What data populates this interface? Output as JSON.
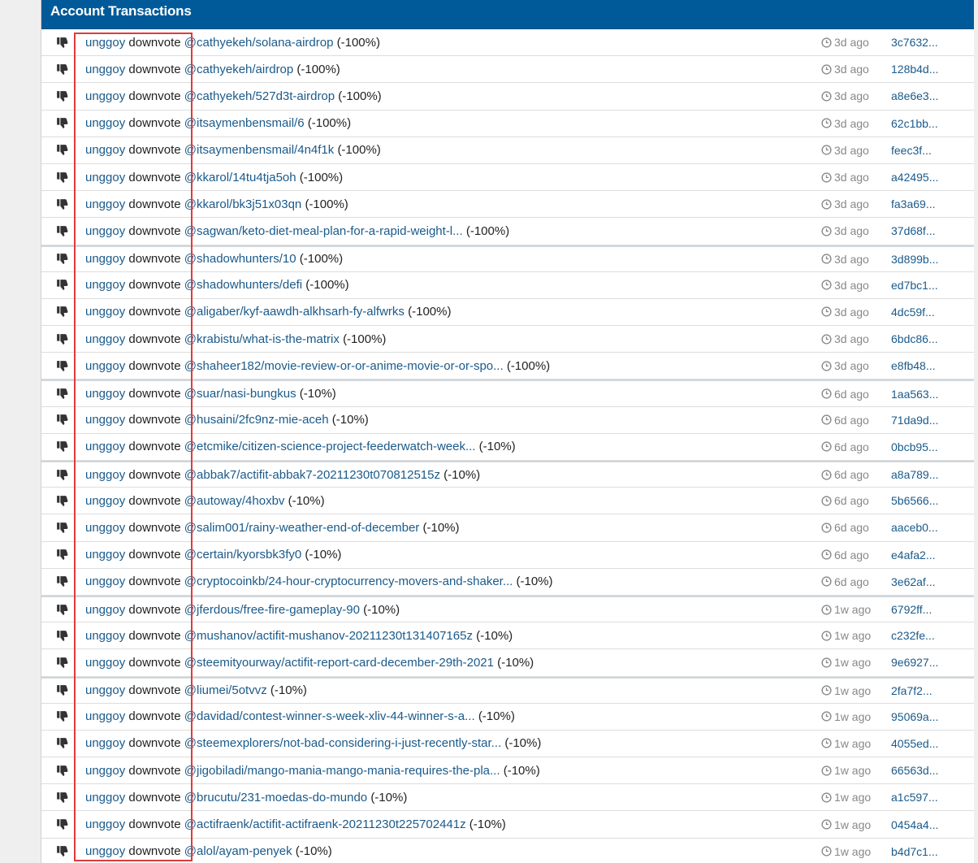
{
  "panel": {
    "title": "Account Transactions"
  },
  "colors": {
    "header_bg": "#005a99",
    "link": "#1a5a8a",
    "highlight": "#e03a3a"
  },
  "icons": {
    "row_icon": "thumbs-down-icon",
    "time_icon": "clock-icon"
  },
  "transactions": [
    {
      "voter": "unggoy",
      "op": "downvote",
      "target": "@cathyekeh/solana-airdrop",
      "weight": "(-100%)",
      "time": "3d ago",
      "hash": "3c7632..."
    },
    {
      "voter": "unggoy",
      "op": "downvote",
      "target": "@cathyekeh/airdrop",
      "weight": "(-100%)",
      "time": "3d ago",
      "hash": "128b4d..."
    },
    {
      "voter": "unggoy",
      "op": "downvote",
      "target": "@cathyekeh/527d3t-airdrop",
      "weight": "(-100%)",
      "time": "3d ago",
      "hash": "a8e6e3..."
    },
    {
      "voter": "unggoy",
      "op": "downvote",
      "target": "@itsaymenbensmail/6",
      "weight": "(-100%)",
      "time": "3d ago",
      "hash": "62c1bb..."
    },
    {
      "voter": "unggoy",
      "op": "downvote",
      "target": "@itsaymenbensmail/4n4f1k",
      "weight": "(-100%)",
      "time": "3d ago",
      "hash": "feec3f..."
    },
    {
      "voter": "unggoy",
      "op": "downvote",
      "target": "@kkarol/14tu4tja5oh",
      "weight": "(-100%)",
      "time": "3d ago",
      "hash": "a42495..."
    },
    {
      "voter": "unggoy",
      "op": "downvote",
      "target": "@kkarol/bk3j51x03qn",
      "weight": "(-100%)",
      "time": "3d ago",
      "hash": "fa3a69..."
    },
    {
      "voter": "unggoy",
      "op": "downvote",
      "target": "@sagwan/keto-diet-meal-plan-for-a-rapid-weight-l...",
      "weight": "(-100%)",
      "time": "3d ago",
      "hash": "37d68f..."
    },
    {
      "voter": "unggoy",
      "op": "downvote",
      "target": "@shadowhunters/10",
      "weight": "(-100%)",
      "time": "3d ago",
      "hash": "3d899b..."
    },
    {
      "voter": "unggoy",
      "op": "downvote",
      "target": "@shadowhunters/defi",
      "weight": "(-100%)",
      "time": "3d ago",
      "hash": "ed7bc1..."
    },
    {
      "voter": "unggoy",
      "op": "downvote",
      "target": "@aligaber/kyf-aawdh-alkhsarh-fy-alfwrks",
      "weight": "(-100%)",
      "time": "3d ago",
      "hash": "4dc59f..."
    },
    {
      "voter": "unggoy",
      "op": "downvote",
      "target": "@krabistu/what-is-the-matrix",
      "weight": "(-100%)",
      "time": "3d ago",
      "hash": "6bdc86..."
    },
    {
      "voter": "unggoy",
      "op": "downvote",
      "target": "@shaheer182/movie-review-or-or-anime-movie-or-or-spo...",
      "weight": "(-100%)",
      "time": "3d ago",
      "hash": "e8fb48..."
    },
    {
      "voter": "unggoy",
      "op": "downvote",
      "target": "@suar/nasi-bungkus",
      "weight": "(-10%)",
      "time": "6d ago",
      "hash": "1aa563..."
    },
    {
      "voter": "unggoy",
      "op": "downvote",
      "target": "@husaini/2fc9nz-mie-aceh",
      "weight": "(-10%)",
      "time": "6d ago",
      "hash": "71da9d..."
    },
    {
      "voter": "unggoy",
      "op": "downvote",
      "target": "@etcmike/citizen-science-project-feederwatch-week...",
      "weight": "(-10%)",
      "time": "6d ago",
      "hash": "0bcb95..."
    },
    {
      "voter": "unggoy",
      "op": "downvote",
      "target": "@abbak7/actifit-abbak7-20211230t070812515z",
      "weight": "(-10%)",
      "time": "6d ago",
      "hash": "a8a789..."
    },
    {
      "voter": "unggoy",
      "op": "downvote",
      "target": "@autoway/4hoxbv",
      "weight": "(-10%)",
      "time": "6d ago",
      "hash": "5b6566..."
    },
    {
      "voter": "unggoy",
      "op": "downvote",
      "target": "@salim001/rainy-weather-end-of-december",
      "weight": "(-10%)",
      "time": "6d ago",
      "hash": "aaceb0..."
    },
    {
      "voter": "unggoy",
      "op": "downvote",
      "target": "@certain/kyorsbk3fy0",
      "weight": "(-10%)",
      "time": "6d ago",
      "hash": "e4afa2..."
    },
    {
      "voter": "unggoy",
      "op": "downvote",
      "target": "@cryptocoinkb/24-hour-cryptocurrency-movers-and-shaker...",
      "weight": "(-10%)",
      "time": "6d ago",
      "hash": "3e62af..."
    },
    {
      "voter": "unggoy",
      "op": "downvote",
      "target": "@jferdous/free-fire-gameplay-90",
      "weight": "(-10%)",
      "time": "1w ago",
      "hash": "6792ff..."
    },
    {
      "voter": "unggoy",
      "op": "downvote",
      "target": "@mushanov/actifit-mushanov-20211230t131407165z",
      "weight": "(-10%)",
      "time": "1w ago",
      "hash": "c232fe..."
    },
    {
      "voter": "unggoy",
      "op": "downvote",
      "target": "@steemityourway/actifit-report-card-december-29th-2021",
      "weight": "(-10%)",
      "time": "1w ago",
      "hash": "9e6927..."
    },
    {
      "voter": "unggoy",
      "op": "downvote",
      "target": "@liumei/5otvvz",
      "weight": "(-10%)",
      "time": "1w ago",
      "hash": "2fa7f2..."
    },
    {
      "voter": "unggoy",
      "op": "downvote",
      "target": "@davidad/contest-winner-s-week-xliv-44-winner-s-a...",
      "weight": "(-10%)",
      "time": "1w ago",
      "hash": "95069a..."
    },
    {
      "voter": "unggoy",
      "op": "downvote",
      "target": "@steemexplorers/not-bad-considering-i-just-recently-star...",
      "weight": "(-10%)",
      "time": "1w ago",
      "hash": "4055ed..."
    },
    {
      "voter": "unggoy",
      "op": "downvote",
      "target": "@jigobiladi/mango-mania-mango-mania-requires-the-pla...",
      "weight": "(-10%)",
      "time": "1w ago",
      "hash": "66563d..."
    },
    {
      "voter": "unggoy",
      "op": "downvote",
      "target": "@brucutu/231-moedas-do-mundo",
      "weight": "(-10%)",
      "time": "1w ago",
      "hash": "a1c597..."
    },
    {
      "voter": "unggoy",
      "op": "downvote",
      "target": "@actifraenk/actifit-actifraenk-20211230t225702441z",
      "weight": "(-10%)",
      "time": "1w ago",
      "hash": "0454a4..."
    },
    {
      "voter": "unggoy",
      "op": "downvote",
      "target": "@alol/ayam-penyek",
      "weight": "(-10%)",
      "time": "1w ago",
      "hash": "b4d7c1..."
    }
  ]
}
